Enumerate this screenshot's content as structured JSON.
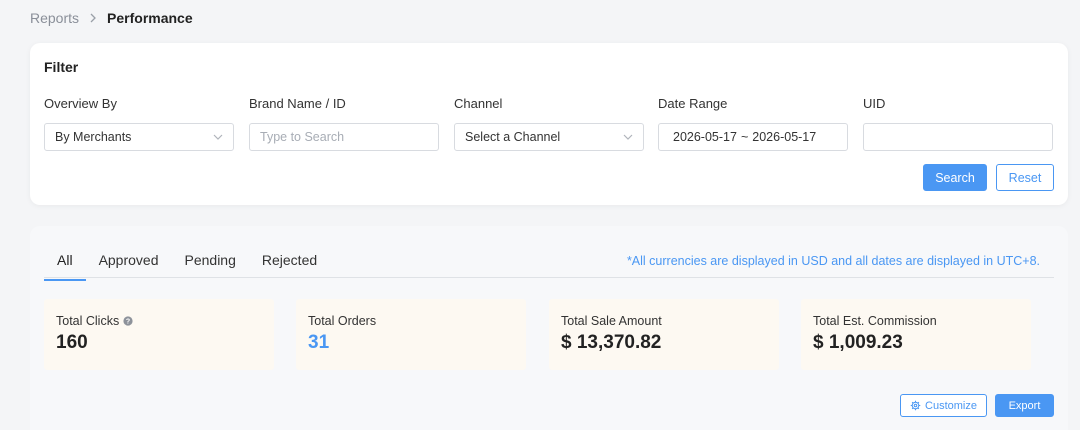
{
  "breadcrumb": {
    "parent": "Reports",
    "current": "Performance"
  },
  "filter": {
    "title": "Filter",
    "fields": {
      "overview_by": {
        "label": "Overview By",
        "value": "By Merchants"
      },
      "brand": {
        "label": "Brand Name / ID",
        "placeholder": "Type to Search"
      },
      "channel": {
        "label": "Channel",
        "value": "Select a Channel"
      },
      "date_range": {
        "label": "Date Range",
        "start": "2026-05-17",
        "separator": "~",
        "end": "2026-05-17"
      },
      "uid": {
        "label": "UID",
        "value": ""
      }
    },
    "search_label": "Search",
    "reset_label": "Reset"
  },
  "results": {
    "tabs": [
      "All",
      "Approved",
      "Pending",
      "Rejected"
    ],
    "active_tab": "All",
    "notice": "*All currencies are displayed in USD and all dates are displayed in UTC+8.",
    "stats": [
      {
        "label": "Total Clicks",
        "value": "160"
      },
      {
        "label": "Total Orders",
        "value": "31"
      },
      {
        "label": "Total Sale Amount",
        "value": "$ 13,370.82"
      },
      {
        "label": "Total Est. Commission",
        "value": "$ 1,009.23"
      }
    ],
    "customize_label": "Customize",
    "export_label": "Export"
  },
  "colors": {
    "accent": "#4a97f3",
    "stat_bg": "#fdf9f2",
    "page_bg": "#f4f5f7"
  },
  "icons": [
    "chevron-right-icon",
    "chevron-down-icon",
    "help-circle-icon",
    "gear-icon"
  ]
}
